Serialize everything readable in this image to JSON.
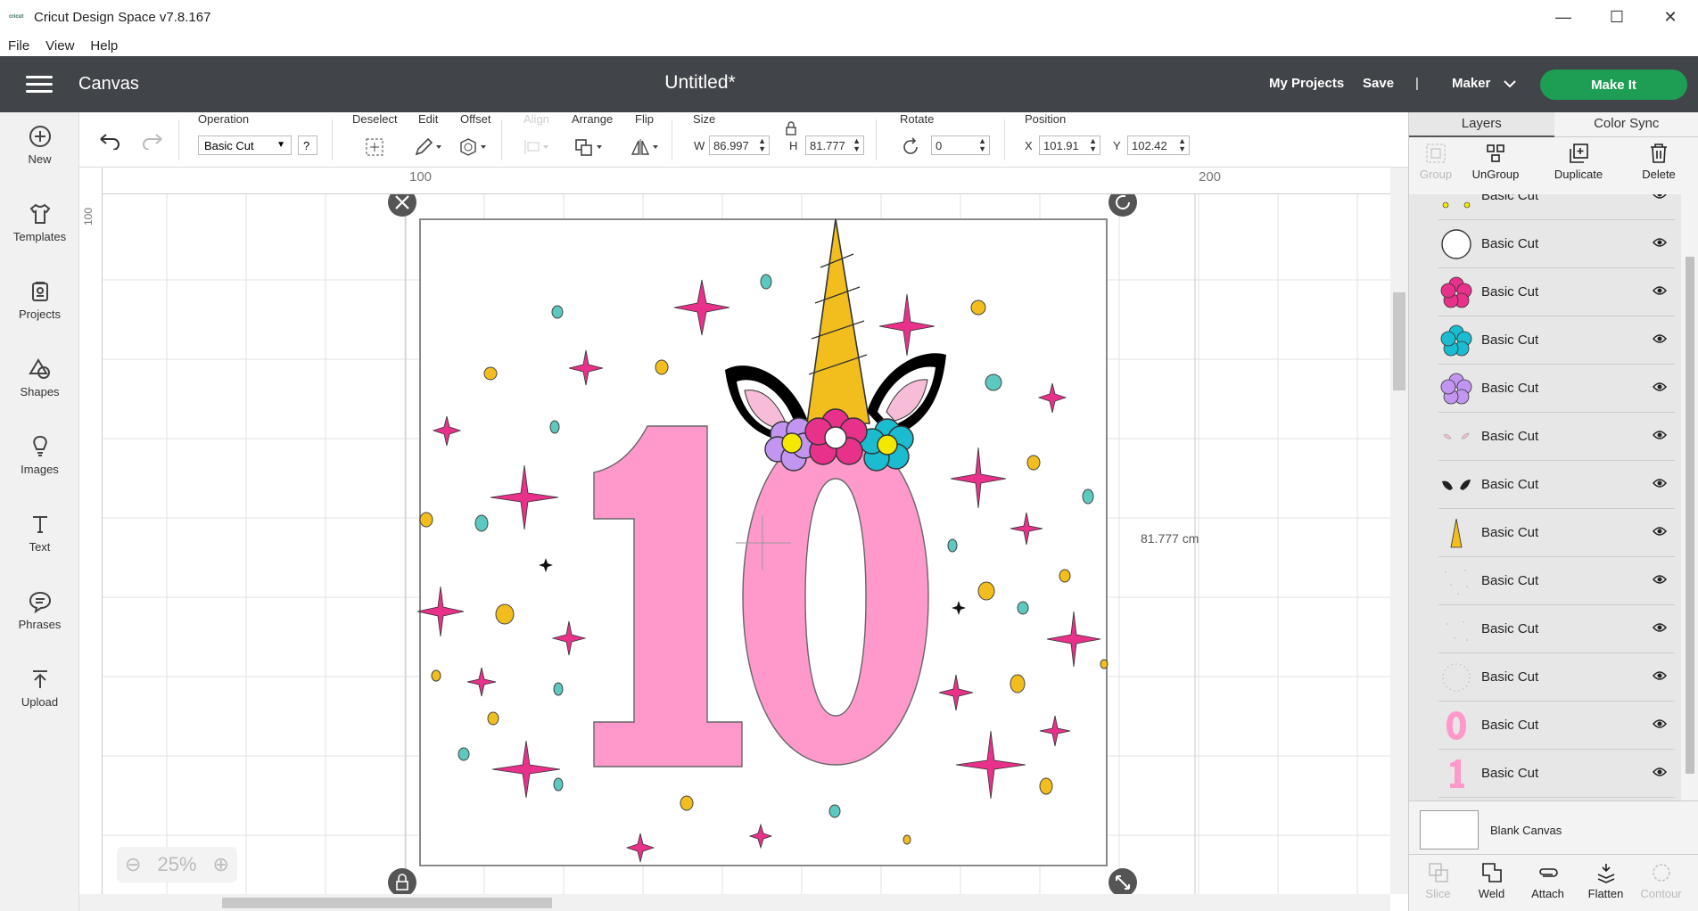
{
  "window": {
    "title": "Cricut Design Space  v7.8.167",
    "icon_text": "cricut",
    "minimize": "—",
    "maximize": "☐",
    "close": "✕"
  },
  "menu": [
    "File",
    "View",
    "Help"
  ],
  "header": {
    "section": "Canvas",
    "doc_title": "Untitled*",
    "my_projects": "My Projects",
    "save": "Save",
    "separator": "|",
    "machine": "Maker",
    "make_it": "Make It"
  },
  "sidebar": [
    {
      "label": "New",
      "icon": "plus-circle-icon"
    },
    {
      "label": "Templates",
      "icon": "shirt-icon"
    },
    {
      "label": "Projects",
      "icon": "projects-icon"
    },
    {
      "label": "Shapes",
      "icon": "shapes-icon"
    },
    {
      "label": "Images",
      "icon": "lightbulb-icon"
    },
    {
      "label": "Text",
      "icon": "text-icon"
    },
    {
      "label": "Phrases",
      "icon": "speech-bubble-icon"
    },
    {
      "label": "Upload",
      "icon": "upload-icon"
    }
  ],
  "toolbar": {
    "operation_label": "Operation",
    "operation_value": "Basic Cut",
    "help": "?",
    "deselect": "Deselect",
    "edit": "Edit",
    "offset": "Offset",
    "align": "Align",
    "arrange": "Arrange",
    "flip": "Flip",
    "size_label": "Size",
    "w_label": "W",
    "w_value": "86.997",
    "h_label": "H",
    "h_value": "81.777",
    "rotate_label": "Rotate",
    "rotate_value": "0",
    "position_label": "Position",
    "x_label": "X",
    "x_value": "101.91",
    "y_label": "Y",
    "y_value": "102.42"
  },
  "canvas": {
    "ruler_top_marks": [
      "100",
      "200"
    ],
    "ruler_left_marks": [
      "100"
    ],
    "height_readout": "81.777 cm",
    "zoom": "25%",
    "zoom_minus": "⊖",
    "zoom_plus": "⊕"
  },
  "right_panel": {
    "tabs": [
      "Layers",
      "Color Sync"
    ],
    "top_actions": [
      {
        "label": "Group",
        "enabled": false
      },
      {
        "label": "UnGroup",
        "enabled": true
      },
      {
        "label": "Duplicate",
        "enabled": true
      },
      {
        "label": "Delete",
        "enabled": true
      }
    ],
    "layers": [
      {
        "name": "Basic Cut",
        "thumb": "yellow-dots"
      },
      {
        "name": "Basic Cut",
        "thumb": "white-circle"
      },
      {
        "name": "Basic Cut",
        "thumb": "pink-flower"
      },
      {
        "name": "Basic Cut",
        "thumb": "cyan-flower"
      },
      {
        "name": "Basic Cut",
        "thumb": "purple-flower"
      },
      {
        "name": "Basic Cut",
        "thumb": "pink-ears"
      },
      {
        "name": "Basic Cut",
        "thumb": "black-ears"
      },
      {
        "name": "Basic Cut",
        "thumb": "gold-horn"
      },
      {
        "name": "Basic Cut",
        "thumb": "faint-dots"
      },
      {
        "name": "Basic Cut",
        "thumb": "faint-dots-2"
      },
      {
        "name": "Basic Cut",
        "thumb": "dot-ring"
      },
      {
        "name": "Basic Cut",
        "thumb": "pink-zero"
      },
      {
        "name": "Basic Cut",
        "thumb": "pink-one"
      }
    ],
    "blank_canvas": "Blank Canvas",
    "bottom_actions": [
      {
        "label": "Slice",
        "enabled": false
      },
      {
        "label": "Weld",
        "enabled": true
      },
      {
        "label": "Attach",
        "enabled": true
      },
      {
        "label": "Flatten",
        "enabled": true
      },
      {
        "label": "Contour",
        "enabled": false
      }
    ]
  },
  "colors": {
    "header_bg": "#414549",
    "make_it": "#1e9e55",
    "pink": "#ff99cc",
    "magenta": "#e8318a",
    "gold": "#f1be1d",
    "cyan": "#1bbbd0",
    "purple": "#c195f0",
    "teal_dot": "#5cc8c0"
  }
}
